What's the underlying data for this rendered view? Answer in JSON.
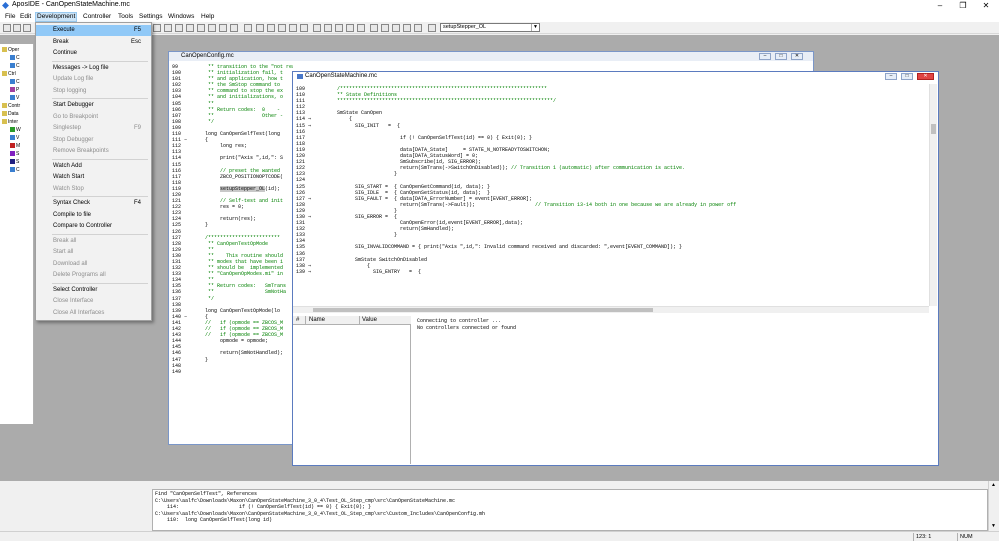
{
  "app": {
    "title": "AposIDE - CanOpenStateMachine.mc"
  },
  "menubar": [
    "File",
    "Edit",
    "Development",
    "Controller",
    "Tools",
    "Settings",
    "Windows",
    "Help"
  ],
  "toolbar": {
    "combo_value": "setupStepper_OL"
  },
  "dropdown": {
    "items": [
      {
        "label": "Execute",
        "shortcut": "F5",
        "disabled": false,
        "selected": true
      },
      {
        "label": "Break",
        "shortcut": "Esc",
        "disabled": false
      },
      {
        "label": "Continue",
        "shortcut": "",
        "disabled": false
      },
      {
        "sep": true
      },
      {
        "label": "Messages -> Log file",
        "shortcut": "",
        "disabled": false
      },
      {
        "label": "Update Log file",
        "shortcut": "",
        "disabled": true
      },
      {
        "label": "Stop logging",
        "shortcut": "",
        "disabled": true
      },
      {
        "sep": true
      },
      {
        "label": "Start Debugger",
        "shortcut": "",
        "disabled": false
      },
      {
        "label": "Go to Breakpoint",
        "shortcut": "",
        "disabled": true
      },
      {
        "label": "Singlestep",
        "shortcut": "F9",
        "disabled": true
      },
      {
        "label": "Stop Debugger",
        "shortcut": "",
        "disabled": true
      },
      {
        "label": "Remove Breakpoints",
        "shortcut": "",
        "disabled": true
      },
      {
        "sep": true
      },
      {
        "label": "Watch Add",
        "shortcut": "",
        "disabled": false
      },
      {
        "label": "Watch Start",
        "shortcut": "",
        "disabled": false
      },
      {
        "label": "Watch Stop",
        "shortcut": "",
        "disabled": true
      },
      {
        "sep": true
      },
      {
        "label": "Syntax Check",
        "shortcut": "F4",
        "disabled": false
      },
      {
        "label": "Compile to file",
        "shortcut": "",
        "disabled": false
      },
      {
        "label": "Compare to Controller",
        "shortcut": "",
        "disabled": false
      },
      {
        "sep": true
      },
      {
        "label": "Break all",
        "shortcut": "",
        "disabled": true
      },
      {
        "label": "Start all",
        "shortcut": "",
        "disabled": true
      },
      {
        "label": "Download all",
        "shortcut": "",
        "disabled": true
      },
      {
        "label": "Delete Programs all",
        "shortcut": "",
        "disabled": true
      },
      {
        "sep": true
      },
      {
        "label": "Select Controller",
        "shortcut": "",
        "disabled": false
      },
      {
        "label": "Close Interface",
        "shortcut": "",
        "disabled": true
      },
      {
        "label": "Close All Interfaces",
        "shortcut": "",
        "disabled": true
      }
    ]
  },
  "tree": {
    "items": [
      "Oper",
      "C",
      "C",
      "Ctrl",
      "C",
      "P",
      "V",
      "Contr",
      "Data",
      "Inter",
      "W",
      "V",
      "M",
      "S",
      "S",
      "C"
    ]
  },
  "config_window": {
    "title": "CanOpenConfig.mc",
    "line_start": 99,
    "lines": [
      "   ** transition to the \"not ready to switch on\" state.  If the test or",
      "   ** initialization fail, t",
      "   ** and application, how t",
      "   ** the SmStop command to",
      "   ** command to stop the ex",
      "   ** and initializations, o",
      "   **",
      "   ** Return codes:  0    -",
      "   **                Other -",
      "   */",
      "",
      "  long CanOpenSelfTest(long",
      "  {",
      "       long res;",
      "",
      "       print(\"Axis \",id,\": S",
      "",
      "       // preset the wanted",
      "       ZBCO_POSITIONOPTCODE(",
      "",
      "       setupStepper_OL(id);",
      "",
      "       // Self-test and init",
      "       res = 0;",
      "",
      "       return(res);",
      "  }",
      "",
      "  /************************",
      "   ** CanOpenTestOpMode",
      "   **",
      "   **    This routine should",
      "   ** modes that have been i",
      "   ** should be  implemented",
      "   ** \"CanOpenOpModes.mi\" in",
      "   **",
      "   ** Return codes:   SmTrans",
      "   **                 SmNotHa",
      "   */",
      "",
      "  long CanOpenTestOpMode(lo",
      "  {",
      "  //   if (opmode == ZBCOS_M",
      "  //   if (opmode == ZBCOS_M",
      "  //   if (opmode == ZBCOS_M",
      "       opmode = opmode;",
      "",
      "       return(SmNotHandled);",
      "  }",
      "",
      ""
    ]
  },
  "sm_window": {
    "title": "CanOpenStateMachine.mc",
    "line_start": 109,
    "lines": [
      "    /*********************************************************************",
      "    ** State Definitions",
      "    ************************************************************************/",
      "",
      "    SmState CanOpen",
      "        {",
      "          SIG_INIT   =  {",
      "",
      "                         if (! CanOpenSelfTest(id) == 0) { Exit(0); }",
      "",
      "                         data[DATA_State]     = STATE_N_NOTREADYTOSWITCHON;",
      "                         data[DATA_StatusWord] = 0;",
      "                         SmSubscribe(id, SIG_ERROR);",
      "                         return(SmTrans(->SwitchOnDisabled)); // Transition 1 (automatic) after communication is active.",
      "                       }",
      "",
      "          SIG_START =  { CanOpenGetCommand(id, data); }",
      "          SIG_IDLE  =  { CanOpenSetStatus(id, data);  }",
      "          SIG_FAULT =  { data[DATA_ErrorNumber] = event[EVENT_ERROR];",
      "                         return(SmTrans(->Fault));                    // Transition 13-14 both in one because we are already in power off",
      "                       }",
      "          SIG_ERROR =  {",
      "                         CanOpenError(id,event[EVENT_ERROR],data);",
      "                         return(SmHandled);",
      "                       }",
      "",
      "          SIG_INVALIDCOMMAND = { print(\"Axis \",id,\": Invalid command received and discarded: \",event[EVENT_COMMAND]); }",
      "",
      "          SmState SwitchOnDisabled",
      "              {",
      "                SIG_ENTRY   =  {"
    ],
    "watch_headers": [
      "Name",
      "Value"
    ],
    "console_lines": [
      "Connecting to controller ...",
      "No controllers connected or found"
    ]
  },
  "output": {
    "lines": [
      "Find \"CanOpenSelfTest\", References",
      "C:\\Users\\aalfc\\Downloads\\Maxon\\CanOpenStateMachine_3_0_4\\Test_OL_Step_cmp\\src\\CanOpenStateMachine.mc",
      "    114:                    if (! CanOpenSelfTest(id) == 0) { Exit(0); }",
      "C:\\Users\\aalfc\\Downloads\\Maxon\\CanOpenStateMachine_3_0_4\\Test_OL_Step_cmp\\src\\Custom_Includes\\CanOpenConfig.mh",
      "    110:  long CanOpenSelfTest(long id)"
    ]
  },
  "status": {
    "position": "123: 1",
    "num": "NUM"
  }
}
